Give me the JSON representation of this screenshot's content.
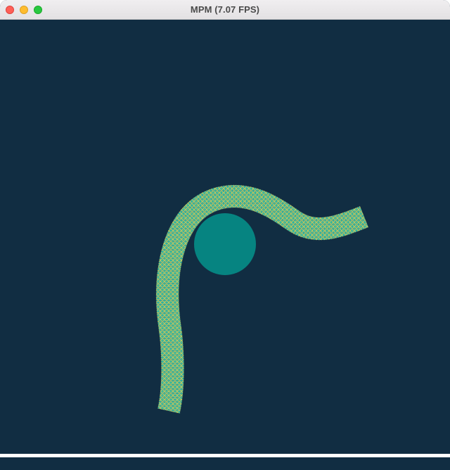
{
  "window": {
    "title": "MPM (7.07 FPS)",
    "buttons": [
      "close-button",
      "minimize-button",
      "zoom-button"
    ]
  },
  "scene": {
    "background_color": "#112d42",
    "obstacle_color": "#068481",
    "particle_colors": [
      "#e8c94a",
      "#2bb3a4",
      "#4fb07a"
    ],
    "floor_color": "#ffffff"
  }
}
